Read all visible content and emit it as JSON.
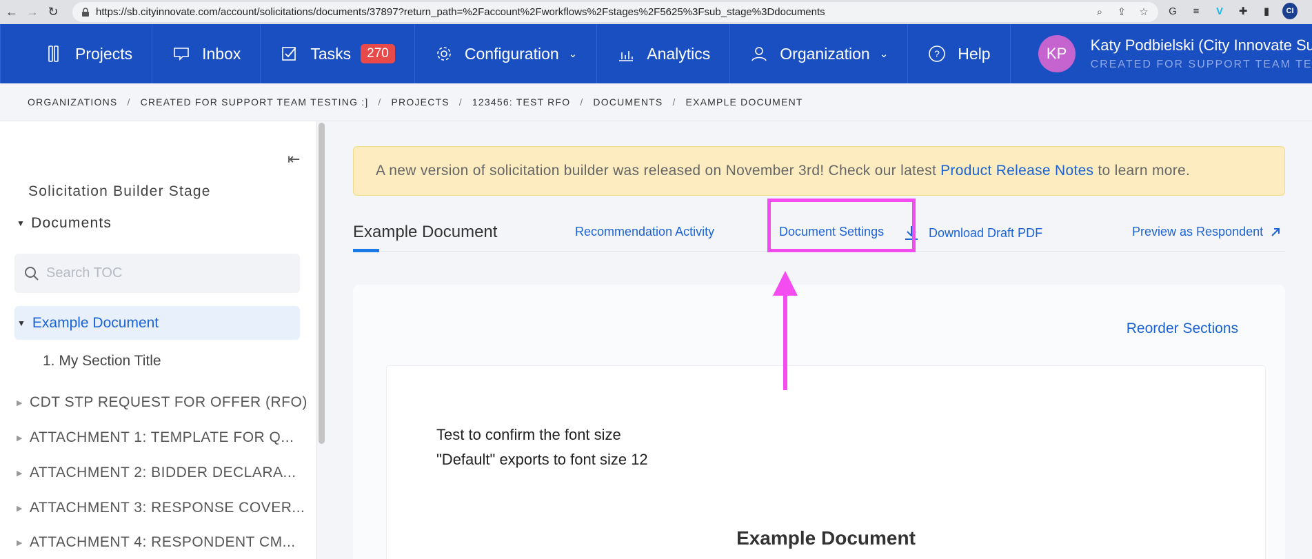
{
  "browser": {
    "url": "https://sb.cityinnovate.com/account/solicitations/documents/37897?return_path=%2Faccount%2Fworkflows%2Fstages%2F5625%3Fsub_stage%3Ddocuments",
    "ext_initials": "CI"
  },
  "nav": {
    "projects": "Projects",
    "inbox": "Inbox",
    "tasks": "Tasks",
    "tasks_count": "270",
    "configuration": "Configuration",
    "analytics": "Analytics",
    "organization": "Organization",
    "help": "Help"
  },
  "user": {
    "initials": "KP",
    "name": "Katy Podbielski (City Innovate Sup",
    "org": "CREATED FOR SUPPORT TEAM TESTING :",
    "avatar_color": "#c564cf"
  },
  "breadcrumb": [
    "ORGANIZATIONS",
    "CREATED FOR SUPPORT TEAM TESTING :]",
    "PROJECTS",
    "123456: TEST RFO",
    "DOCUMENTS",
    "EXAMPLE DOCUMENT"
  ],
  "sidebar": {
    "stage": "Solicitation Builder Stage",
    "documents": "Documents",
    "search_placeholder": "Search TOC",
    "active_doc": "Example Document",
    "section": "1. My Section Title",
    "items": [
      "CDT STP REQUEST FOR OFFER (RFO)",
      "ATTACHMENT 1: TEMPLATE FOR Q...",
      "ATTACHMENT 2: BIDDER DECLARA...",
      "ATTACHMENT 3: RESPONSE COVER...",
      "ATTACHMENT 4: RESPONDENT CM..."
    ]
  },
  "banner": {
    "before": "A new version of solicitation builder was released on November 3rd! Check our latest",
    "link": "Product Release Notes",
    "after": "to learn more."
  },
  "tabs": {
    "title": "Example Document",
    "recommendation": "Recommendation Activity",
    "settings": "Document Settings",
    "download": "Download Draft PDF",
    "preview": "Preview as Respondent"
  },
  "panel": {
    "reorder": "Reorder Sections",
    "text_line1": "Test to confirm the font size",
    "text_line2": "\"Default\" exports to font size 12",
    "heading": "Example Document"
  },
  "colors": {
    "nav_bg": "#1a4fc2",
    "link": "#1a62d6",
    "annotation": "#f34cf0",
    "badge": "#e84a4a"
  }
}
